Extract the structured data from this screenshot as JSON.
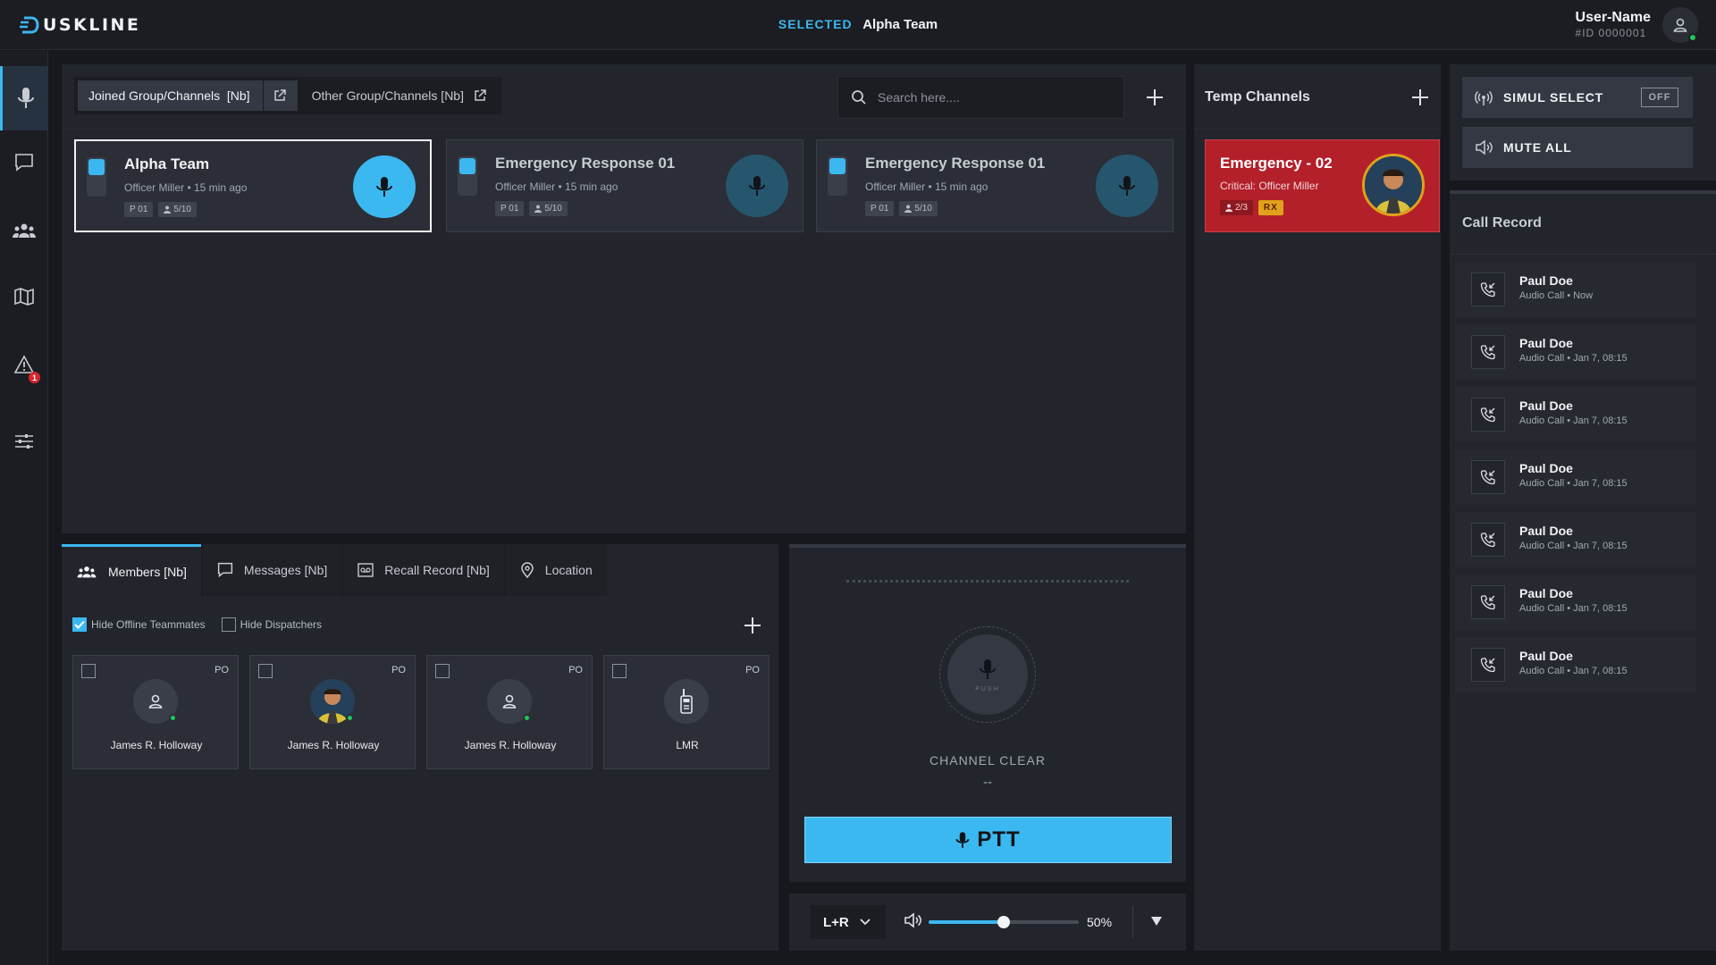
{
  "app": {
    "logo_text": "USKLINE",
    "selected_label": "SELECTED",
    "selected_value": "Alpha Team",
    "user_name": "User-Name",
    "user_id": "#ID 0000001"
  },
  "rail": {
    "alerts_badge": "1",
    "items": [
      "microphone",
      "messages",
      "groups",
      "map",
      "alerts",
      "settings"
    ]
  },
  "channels": {
    "tabs": [
      {
        "label": "Joined Group/Channels  [Nb]"
      },
      {
        "label": "Other Group/Channels [Nb]"
      }
    ],
    "search_placeholder": "Search here....",
    "cards": [
      {
        "name": "Alpha Team",
        "sub": "Officer Miller • 15 min ago",
        "chip_p": "P 01",
        "chip_members": "5/10"
      },
      {
        "name": "Emergency Response 01",
        "sub": "Officer Miller • 15 min ago",
        "chip_p": "P 01",
        "chip_members": "5/10"
      },
      {
        "name": "Emergency Response 01",
        "sub": "Officer Miller • 15 min ago",
        "chip_p": "P 01",
        "chip_members": "5/10"
      }
    ]
  },
  "temp": {
    "title": "Temp Channels",
    "card": {
      "name": "Emergency - 02",
      "sub": "Critical: Officer Miller",
      "chip_members": "2/3",
      "chip_rx": "RX"
    }
  },
  "controls": {
    "simul_label": "SIMUL SELECT",
    "simul_state": "OFF",
    "mute_label": "MUTE ALL"
  },
  "call_record": {
    "title": "Call Record",
    "items": [
      {
        "name": "Paul Doe",
        "sub": "Audio Call • Now"
      },
      {
        "name": "Paul Doe",
        "sub": "Audio Call • Jan 7, 08:15"
      },
      {
        "name": "Paul Doe",
        "sub": "Audio Call • Jan 7, 08:15"
      },
      {
        "name": "Paul Doe",
        "sub": "Audio Call • Jan 7, 08:15"
      },
      {
        "name": "Paul Doe",
        "sub": "Audio Call • Jan 7, 08:15"
      },
      {
        "name": "Paul Doe",
        "sub": "Audio Call • Jan 7, 08:15"
      },
      {
        "name": "Paul Doe",
        "sub": "Audio Call • Jan 7, 08:15"
      }
    ]
  },
  "bottom": {
    "tabs": [
      {
        "label": "Members [Nb]"
      },
      {
        "label": "Messages [Nb]"
      },
      {
        "label": "Recall Record [Nb]"
      },
      {
        "label": "Location"
      }
    ],
    "filter_offline": "Hide Offline Teammates",
    "filter_dispatchers": "Hide Dispatchers",
    "members": [
      {
        "name": "James R. Holloway",
        "po": "PO"
      },
      {
        "name": "James R. Holloway",
        "po": "PO"
      },
      {
        "name": "James R. Holloway",
        "po": "PO"
      },
      {
        "name": "LMR",
        "po": "PO"
      }
    ]
  },
  "ptt": {
    "push_label": "PUSH",
    "status": "CHANNEL CLEAR",
    "status_sub": "--",
    "button_label": "PTT"
  },
  "audio": {
    "channel_mode": "L+R",
    "volume_label": "50%",
    "volume_fraction": 0.5
  }
}
